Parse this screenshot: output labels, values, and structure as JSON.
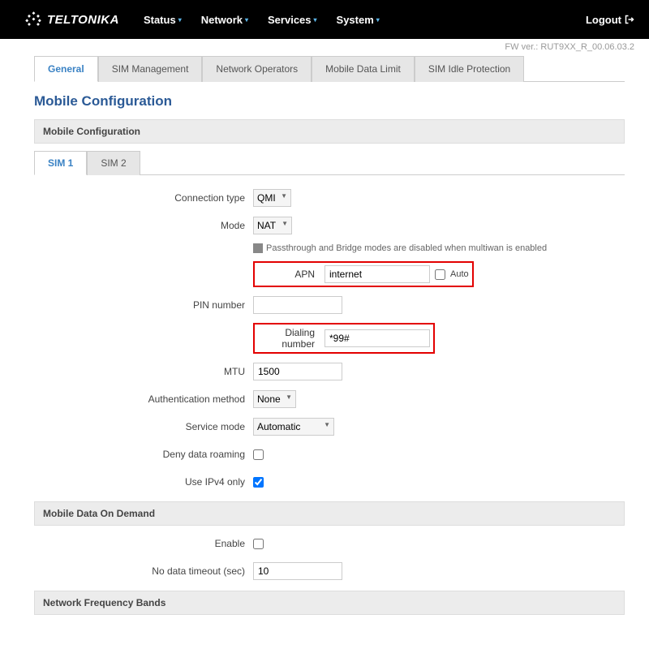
{
  "header": {
    "brand": "TELTONIKA",
    "nav": {
      "status": "Status",
      "network": "Network",
      "services": "Services",
      "system": "System"
    },
    "logout": "Logout"
  },
  "fw": "FW ver.: RUT9XX_R_00.06.03.2",
  "tabs": {
    "general": "General",
    "sim_management": "SIM Management",
    "network_operators": "Network Operators",
    "mobile_data_limit": "Mobile Data Limit",
    "sim_idle_protection": "SIM Idle Protection"
  },
  "page_title": "Mobile Configuration",
  "sections": {
    "mobile_config": "Mobile Configuration",
    "mobile_data_on_demand": "Mobile Data On Demand",
    "network_frequency_bands": "Network Frequency Bands"
  },
  "sim_tabs": {
    "sim1": "SIM 1",
    "sim2": "SIM 2"
  },
  "form": {
    "connection_type": {
      "label": "Connection type",
      "value": "QMI"
    },
    "mode": {
      "label": "Mode",
      "value": "NAT"
    },
    "mode_hint": "Passthrough and Bridge modes are disabled when multiwan is enabled",
    "apn": {
      "label": "APN",
      "value": "internet",
      "auto_label": "Auto"
    },
    "pin": {
      "label": "PIN number",
      "value": ""
    },
    "dialing": {
      "label": "Dialing number",
      "value": "*99#"
    },
    "mtu": {
      "label": "MTU",
      "value": "1500"
    },
    "auth": {
      "label": "Authentication method",
      "value": "None"
    },
    "service_mode": {
      "label": "Service mode",
      "value": "Automatic"
    },
    "deny_roaming": {
      "label": "Deny data roaming"
    },
    "use_ipv4_only": {
      "label": "Use IPv4 only"
    },
    "od_enable": {
      "label": "Enable"
    },
    "od_timeout": {
      "label": "No data timeout (sec)",
      "value": "10"
    }
  }
}
